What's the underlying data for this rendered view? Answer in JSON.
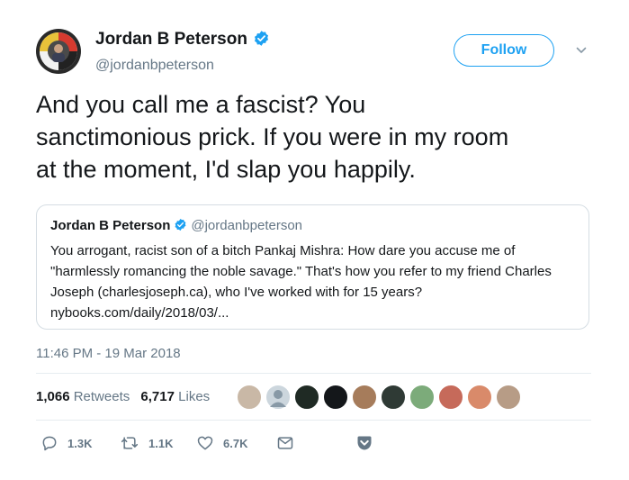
{
  "author": {
    "name": "Jordan B Peterson",
    "handle": "@jordanbpeterson",
    "verified": true
  },
  "follow_label": "Follow",
  "tweet_lines": [
    "And you call me a fascist? You",
    "sanctimonious prick. If you were in my room",
    "at the moment, I'd slap you happily."
  ],
  "quoted": {
    "name": "Jordan B Peterson",
    "handle": "@jordanbpeterson",
    "lines": [
      "You arrogant, racist son of a bitch Pankaj Mishra: How dare you accuse me of",
      "\"harmlessly romancing the noble savage.\" That's how you refer to my friend Charles",
      "Joseph (charlesjoseph.ca), who I've worked with for 15 years?",
      "nybooks.com/daily/2018/03/..."
    ]
  },
  "timestamp": "11:46 PM - 19 Mar 2018",
  "stats": {
    "retweets_count": "1,066",
    "retweets_label": "Retweets",
    "likes_count": "6,717",
    "likes_label": "Likes"
  },
  "actions": {
    "replies": "1.3K",
    "retweets": "1.1K",
    "likes": "6.7K"
  },
  "colors": {
    "accent": "#1da1f2",
    "text": "#14171a",
    "muted": "#657786",
    "divider": "#e6ecf0"
  },
  "icons": [
    "verified-badge-icon",
    "chevron-down-icon",
    "reply-icon",
    "retweet-icon",
    "like-icon",
    "direct-message-icon",
    "pocket-icon"
  ]
}
